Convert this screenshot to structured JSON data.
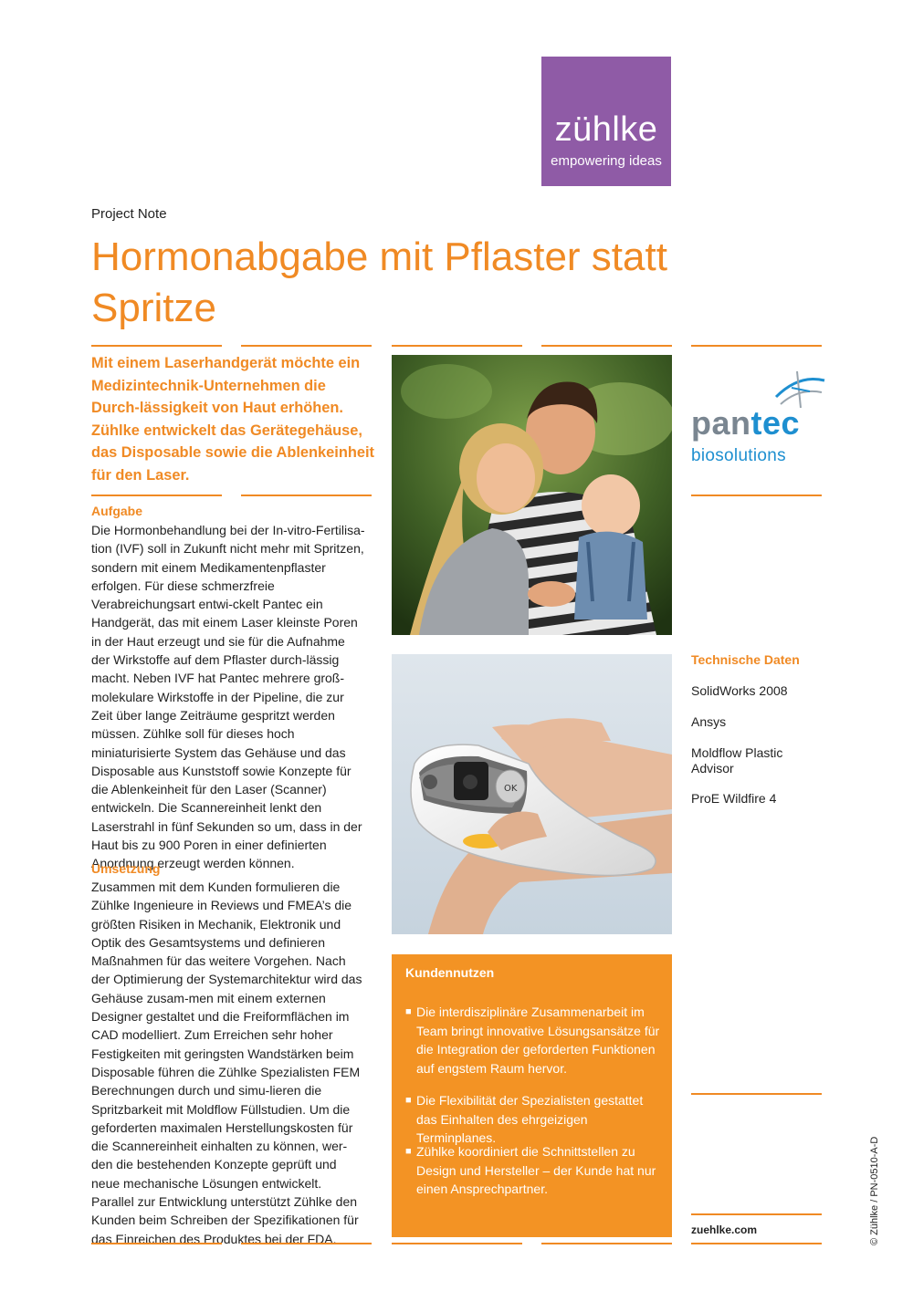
{
  "logo": {
    "brand": "zühlke",
    "tagline": "empowering ideas",
    "color": "#8f5ba6"
  },
  "header": {
    "kicker": "Project Note",
    "title": "Hormonabgabe mit Pflaster statt Spritze"
  },
  "lead": "Mit einem Laserhandgerät möchte ein Medizintechnik-Unternehmen die Durch-lässigkeit von Haut erhöhen. Zühlke entwickelt das Gerätegehäuse, das Disposable sowie die Ablenkeinheit für den Laser.",
  "aufgabe": {
    "heading": "Aufgabe",
    "text": "Die Hormonbehandlung bei der In-vitro-Fertilisa-tion (IVF) soll in Zukunft nicht mehr mit Spritzen, sondern mit einem Medikamentenpflaster erfolgen. Für diese schmerzfreie Verabreichungsart entwi-ckelt Pantec ein Handgerät, das mit einem Laser kleinste Poren in der Haut erzeugt und sie für die Aufnahme der Wirkstoffe auf dem Pflaster durch-lässig macht. Neben IVF hat Pantec mehrere groß-molekulare Wirkstoffe in der Pipeline, die zur Zeit über lange Zeiträume gespritzt werden müssen. Zühlke soll für dieses hoch miniaturisierte System das Gehäuse und das Disposable aus Kunststoff sowie Konzepte für die Ablenkeinheit für den Laser (Scanner) entwickeln. Die Scannereinheit lenkt den Laserstrahl in fünf Sekunden so um, dass in der Haut bis zu 900 Poren in einer definierten Anordnung erzeugt werden können."
  },
  "umsetzung": {
    "heading": "Umsetzung",
    "text": "Zusammen mit dem Kunden formulieren die Zühlke Ingenieure in Reviews und FMEA’s die größten Risiken in Mechanik, Elektronik und Optik des Gesamtsystems und definieren Maßnahmen für das weitere Vorgehen. Nach der Optimierung der Systemarchitektur wird das Gehäuse zusam-men mit einem externen Designer gestaltet und die Freiformflächen im CAD modelliert. Zum Erreichen sehr hoher Festigkeiten mit geringsten Wandstärken beim Disposable führen die Zühlke Spezialisten FEM Berechnungen durch und simu-lieren die Spritzbarkeit mit Moldflow Füllstudien. Um die geforderten maximalen Herstellungskosten für die Scannereinheit einhalten zu können, wer-den die bestehenden Konzepte geprüft und neue mechanische Lösungen entwickelt. Parallel zur Entwicklung unterstützt Zühlke den Kunden beim Schreiben der Spezifikationen für das Einreichen des Produktes bei der FDA."
  },
  "partner": {
    "name_part1": "pan",
    "name_part2": "tec",
    "subline": "biosolutions"
  },
  "tech": {
    "heading": "Technische Daten",
    "items": [
      "SolidWorks 2008",
      "Ansys",
      "Moldflow Plastic Advisor",
      "ProE Wildfire 4"
    ]
  },
  "benefits": {
    "heading": "Kundennutzen",
    "items": [
      "Die interdisziplinäre Zusammenarbeit im Team bringt innovative Lösungsansätze für die Integration der geforderten Funktionen auf engstem Raum hervor.",
      "Die Flexibilität der Spezialisten gestattet das Einhalten des ehrgeizigen Terminplanes.",
      "Zühlke koordiniert die Schnittstellen zu Design und Hersteller – der Kunde hat nur einen Ansprechpartner."
    ],
    "color": "#f39324"
  },
  "footer": {
    "site": "zuehlke.com",
    "copyright": "© Zühlke / PN-0510-A-D"
  },
  "device_screen_label": "OK",
  "accent_color": "#f08a24"
}
